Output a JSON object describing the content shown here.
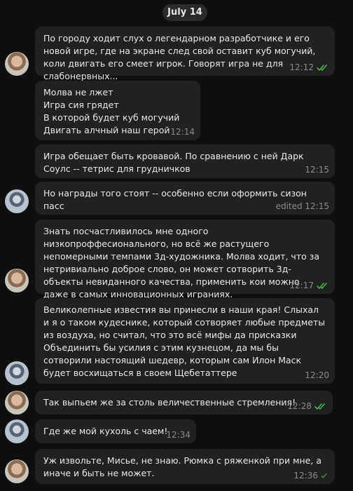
{
  "date_label": "July 14",
  "messages": [
    {
      "text": "По городу ходит слух о легендарном разработчике и его новой игре, где на экране след свой оставит куб могучий, коли двигать его смеет игрок. Говорят игра не для слабонервных...",
      "time": "12:12",
      "status": "read"
    },
    {
      "text": "Молва не лжет\nИгра сия грядет\nВ которой будет куб могучий\nДвигать алчный наш герой",
      "time": "12:14",
      "status": "none"
    },
    {
      "text": "Игра обещает быть кровавой. По сравнению с ней Дарк Соулс -- тетрис для грудничков",
      "time": "12:15",
      "status": "none"
    },
    {
      "text": "Но награды того стоят -- особенно если оформить сизон пасс",
      "time": "edited 12:15",
      "status": "none"
    },
    {
      "text": "Знать посчастливилось мне одного низкопроффесионального, но всё же растущего непомерными темпами 3д-художника. Молва ходит, что за нетривиально доброе слово, он может сотворить 3д-объекты невиданного качества, применить кои можно даже в самых инновационных играниях.",
      "time": "12:17",
      "status": "read"
    },
    {
      "text": "Великолепные известия вы принесли в наши края! Слыхал и я о таком кудеснике, который сотворяет любые предметы из воздуха, но считал, что это всё мифы да присказки\nОбъединить бы усилия с этим кузнецом, да мы бы сотворили настоящий шедевр, которым сам Илон Маск будет восхищаться в своем Щебетаттере",
      "time": "12:20",
      "status": "none"
    },
    {
      "text": "Так выпьем же за столь величественные стремления!",
      "time": "12:28",
      "status": "read"
    },
    {
      "text": "Где же мой кухоль с чаем!",
      "time": "12:34",
      "status": "none"
    },
    {
      "text": "Уж извольте, Мисье, не знаю. Рюмка с ряженкой при мне, а иначе и быть не может.",
      "time": "12:36",
      "status": "sent"
    }
  ],
  "colors": {
    "bubble": "#212121",
    "background": "#0f0f0f",
    "check": "#4fae4e",
    "meta": "#8a8a8a"
  },
  "icons": [
    "avatar-photo",
    "double-check-icon",
    "single-check-icon"
  ]
}
